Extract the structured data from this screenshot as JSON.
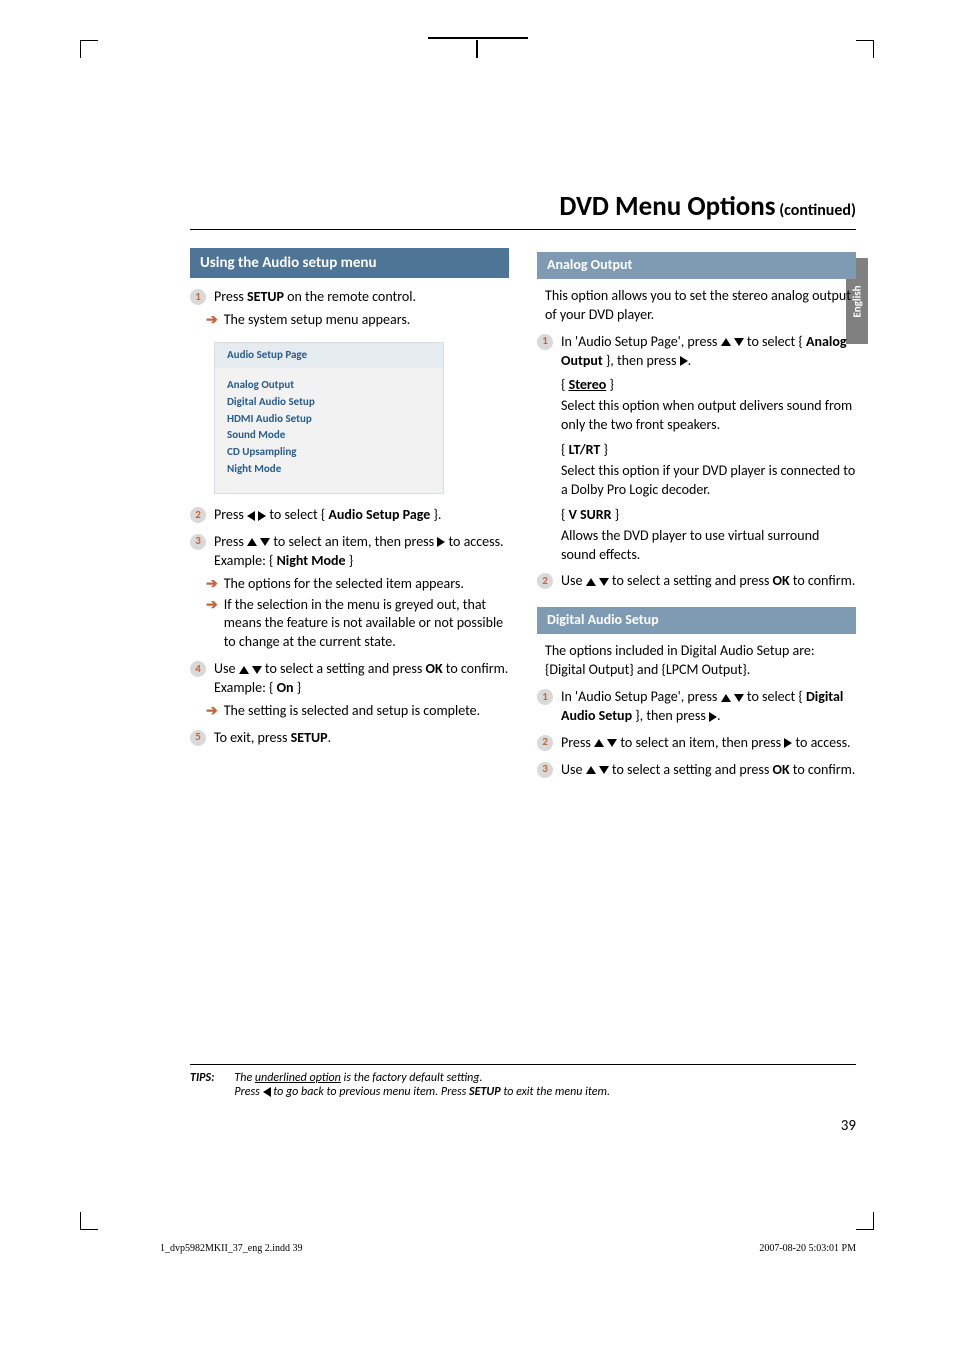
{
  "header": {
    "title": "DVD Menu Options",
    "continued": "(continued)"
  },
  "side_tab": "English",
  "left": {
    "section_title": "Using the Audio setup menu",
    "step1_a": "Press ",
    "step1_b": "SETUP",
    "step1_c": " on the remote control.",
    "step1_sub": "The system setup menu appears.",
    "menu": {
      "title": "Audio Setup Page",
      "items": [
        "Analog Output",
        "Digital Audio Setup",
        "HDMI Audio Setup",
        "Sound Mode",
        "CD Upsampling",
        "Night Mode"
      ]
    },
    "step2_a": "Press ",
    "step2_b": " to select { ",
    "step2_c": "Audio Setup Page",
    "step2_d": " }.",
    "step3_a": "Press ",
    "step3_b": " to select an item, then press ",
    "step3_c": " to access.",
    "step3_ex_a": "Example: { ",
    "step3_ex_b": "Night Mode",
    "step3_ex_c": " }",
    "step3_sub1": "The options for the selected item appears.",
    "step3_sub2": "If the selection in the menu is greyed out, that means the feature is not available or not possible to change at the current state.",
    "step4_a": "Use ",
    "step4_b": " to select a setting and press ",
    "step4_c": "OK",
    "step4_d": " to confirm.",
    "step4_ex_a": "Example: { ",
    "step4_ex_b": "On",
    "step4_ex_c": " }",
    "step4_sub": "The setting is selected and setup is complete.",
    "step5_a": "To exit, press ",
    "step5_b": "SETUP",
    "step5_c": "."
  },
  "right": {
    "analog": {
      "bar": "Analog Output",
      "intro": "This option allows you to set the stereo analog output of your DVD player.",
      "step1_a": "In 'Audio Setup Page', press ",
      "step1_b": " to select { ",
      "step1_c": "Analog Output",
      "step1_d": " }, then press ",
      "step1_e": ".",
      "opt1_label": "Stereo",
      "opt1_desc": "Select this option when output delivers sound from only the two front speakers.",
      "opt2_label": "LT/RT",
      "opt2_desc": "Select this option if your DVD player is connected to a Dolby Pro Logic decoder.",
      "opt3_label": "V SURR",
      "opt3_desc": "Allows the DVD player to use virtual surround sound effects.",
      "step2_a": "Use ",
      "step2_b": " to select a setting and press ",
      "step2_c": "OK",
      "step2_d": " to confirm."
    },
    "digital": {
      "bar": "Digital Audio Setup",
      "intro": "The options included in Digital Audio Setup are: {Digital Output} and {LPCM Output}.",
      "step1_a": "In 'Audio Setup Page', press ",
      "step1_b": " to select { ",
      "step1_c": "Digital Audio Setup",
      "step1_d": " }, then press ",
      "step1_e": ".",
      "step2_a": "Press ",
      "step2_b": " to select an item, then press ",
      "step2_c": " to access.",
      "step3_a": "Use ",
      "step3_b": " to select a setting and press ",
      "step3_c": "OK",
      "step3_d": " to confirm."
    }
  },
  "tips": {
    "label": "TIPS:",
    "line1_a": "The ",
    "line1_b": "underlined option",
    "line1_c": " is the factory default setting.",
    "line2_a": "Press ",
    "line2_b": " to go back to previous menu item. Press ",
    "line2_c": "SETUP",
    "line2_d": " to exit the menu item."
  },
  "page_number": "39",
  "footer": {
    "left": "1_dvp5982MKII_37_eng 2.indd   39",
    "right": "2007-08-20   5:03:01 PM"
  }
}
